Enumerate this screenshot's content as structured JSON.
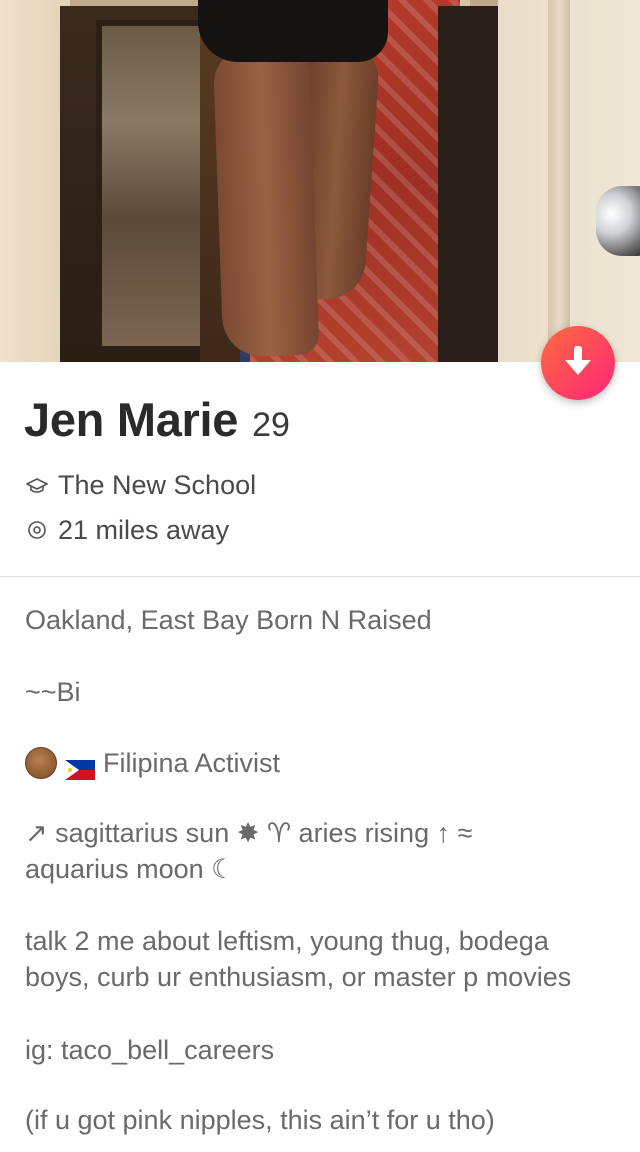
{
  "profile": {
    "name": "Jen Marie",
    "age": "29",
    "school": "The New School",
    "distance": "21 miles away"
  },
  "bio": {
    "line1": "Oakland, East Bay Born N Raised",
    "line2": "~~Bi",
    "line3": "Filipina Activist",
    "line4": "↗ sagittarius sun ✸ ♈ aries rising ↑ ≈",
    "line5": "aquarius moon ☾",
    "line6": "talk 2 me about leftism, young thug, bodega",
    "line7": "boys, curb ur enthusiasm, or master p movies",
    "line8": "ig: taco_bell_careers",
    "line9": "(if u got pink nipples, this ain’t for u tho)"
  },
  "icons": {
    "fab": "down-arrow-icon",
    "school": "graduation-cap-icon",
    "distance": "location-pin-icon",
    "emoji1": "raised-fist-emoji",
    "emoji2": "philippines-flag-emoji"
  },
  "colors": {
    "fab_gradient_start": "#ff6a3d",
    "fab_gradient_end": "#fd267a",
    "name_text": "#2a2a2a",
    "bio_text": "#6a6a6a"
  }
}
